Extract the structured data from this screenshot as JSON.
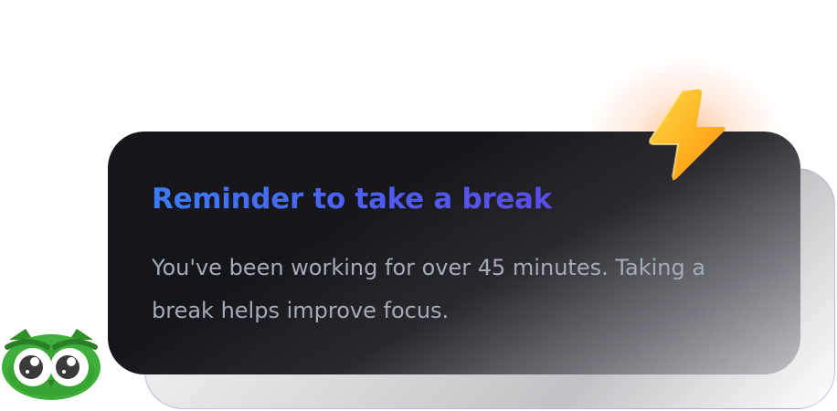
{
  "notification": {
    "title": "Reminder to take a break",
    "message": "You've been working for over 45 minutes. Taking a break helps improve focus."
  },
  "icons": {
    "badge": "lightning-bolt-icon",
    "mascot": "owl-mascot-icon"
  },
  "colors": {
    "title_gradient_start": "#3b7cf7",
    "title_gradient_end": "#5b4ce8",
    "message_text": "#a6abb8",
    "card_background": "#15161b",
    "bolt": "#ffb020",
    "mascot_green": "#3fae3a"
  }
}
